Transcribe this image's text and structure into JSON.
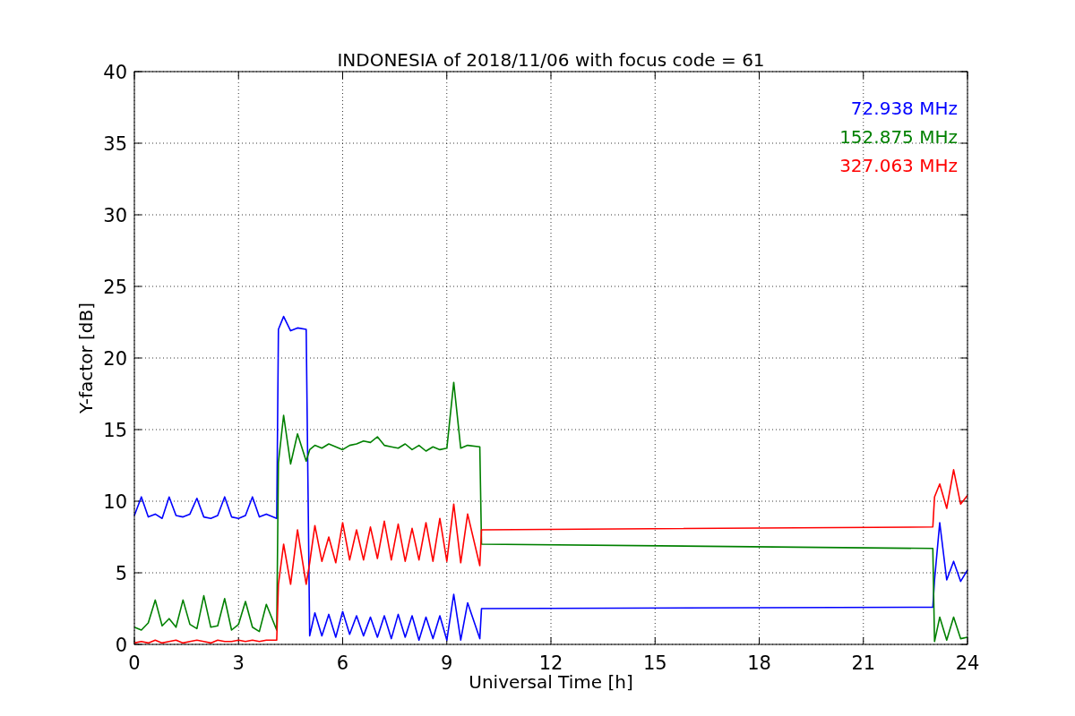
{
  "chart_data": {
    "type": "line",
    "title": "INDONESIA of 2018/11/06 with focus code = 61",
    "xlabel": "Universal Time [h]",
    "ylabel": "Y-factor [dB]",
    "xlim": [
      0,
      24
    ],
    "ylim": [
      0,
      40
    ],
    "xticks": [
      0,
      3,
      6,
      9,
      12,
      15,
      18,
      21,
      24
    ],
    "yticks": [
      0,
      5,
      10,
      15,
      20,
      25,
      30,
      35,
      40
    ],
    "grid": true,
    "x": [
      0,
      0.2,
      0.4,
      0.6,
      0.8,
      1.0,
      1.2,
      1.4,
      1.6,
      1.8,
      2.0,
      2.2,
      2.4,
      2.6,
      2.8,
      3.0,
      3.2,
      3.4,
      3.6,
      3.8,
      4.1,
      4.15,
      4.3,
      4.5,
      4.7,
      4.95,
      5.05,
      5.2,
      5.4,
      5.6,
      5.8,
      6.0,
      6.2,
      6.4,
      6.6,
      6.8,
      7.0,
      7.2,
      7.4,
      7.6,
      7.8,
      8.0,
      8.2,
      8.4,
      8.6,
      8.8,
      9.0,
      9.2,
      9.4,
      9.6,
      9.95,
      10.0,
      23.0,
      23.05,
      23.2,
      23.4,
      23.6,
      23.8,
      24.0
    ],
    "series": [
      {
        "name": "72.938 MHz",
        "color": "#0000ff",
        "values": [
          9.0,
          10.3,
          8.9,
          9.1,
          8.8,
          10.3,
          9.0,
          8.9,
          9.1,
          10.2,
          8.9,
          8.8,
          9.0,
          10.3,
          8.9,
          8.8,
          9.0,
          10.3,
          8.9,
          9.1,
          8.8,
          22.0,
          22.9,
          21.9,
          22.1,
          22.0,
          0.6,
          2.2,
          0.6,
          2.1,
          0.5,
          2.3,
          0.7,
          2.0,
          0.6,
          1.9,
          0.5,
          2.0,
          0.4,
          2.1,
          0.5,
          2.0,
          0.3,
          1.9,
          0.4,
          2.0,
          0.3,
          3.5,
          0.3,
          2.9,
          0.4,
          2.5,
          2.6,
          4.5,
          8.5,
          4.5,
          5.8,
          4.4,
          5.2
        ]
      },
      {
        "name": "152.875 MHz",
        "color": "#008000",
        "values": [
          1.2,
          1.0,
          1.5,
          3.1,
          1.3,
          1.8,
          1.2,
          3.1,
          1.4,
          1.1,
          3.4,
          1.2,
          1.3,
          3.2,
          1.0,
          1.4,
          3.0,
          1.2,
          0.9,
          2.8,
          1.0,
          12.7,
          16.0,
          12.6,
          14.7,
          12.8,
          13.6,
          13.9,
          13.7,
          14.0,
          13.8,
          13.6,
          13.9,
          14.0,
          14.2,
          14.1,
          14.5,
          13.9,
          13.8,
          13.7,
          14.0,
          13.6,
          13.9,
          13.5,
          13.8,
          13.6,
          13.7,
          18.3,
          13.7,
          13.9,
          13.8,
          7.0,
          6.7,
          0.2,
          1.9,
          0.3,
          1.9,
          0.4,
          0.5
        ]
      },
      {
        "name": "327.063 MHz",
        "color": "#ff0000",
        "values": [
          0.1,
          0.2,
          0.1,
          0.3,
          0.1,
          0.2,
          0.3,
          0.1,
          0.2,
          0.3,
          0.2,
          0.1,
          0.3,
          0.2,
          0.2,
          0.3,
          0.2,
          0.3,
          0.2,
          0.3,
          0.3,
          4.2,
          7.0,
          4.2,
          8.0,
          4.2,
          5.7,
          8.3,
          5.8,
          7.5,
          5.7,
          8.5,
          5.9,
          8.0,
          5.9,
          8.2,
          6.0,
          8.6,
          5.9,
          8.4,
          5.8,
          8.1,
          5.9,
          8.5,
          5.8,
          8.8,
          5.8,
          9.8,
          5.7,
          9.1,
          5.5,
          8.0,
          8.2,
          10.3,
          11.2,
          9.5,
          12.2,
          9.8,
          10.4
        ]
      }
    ]
  }
}
